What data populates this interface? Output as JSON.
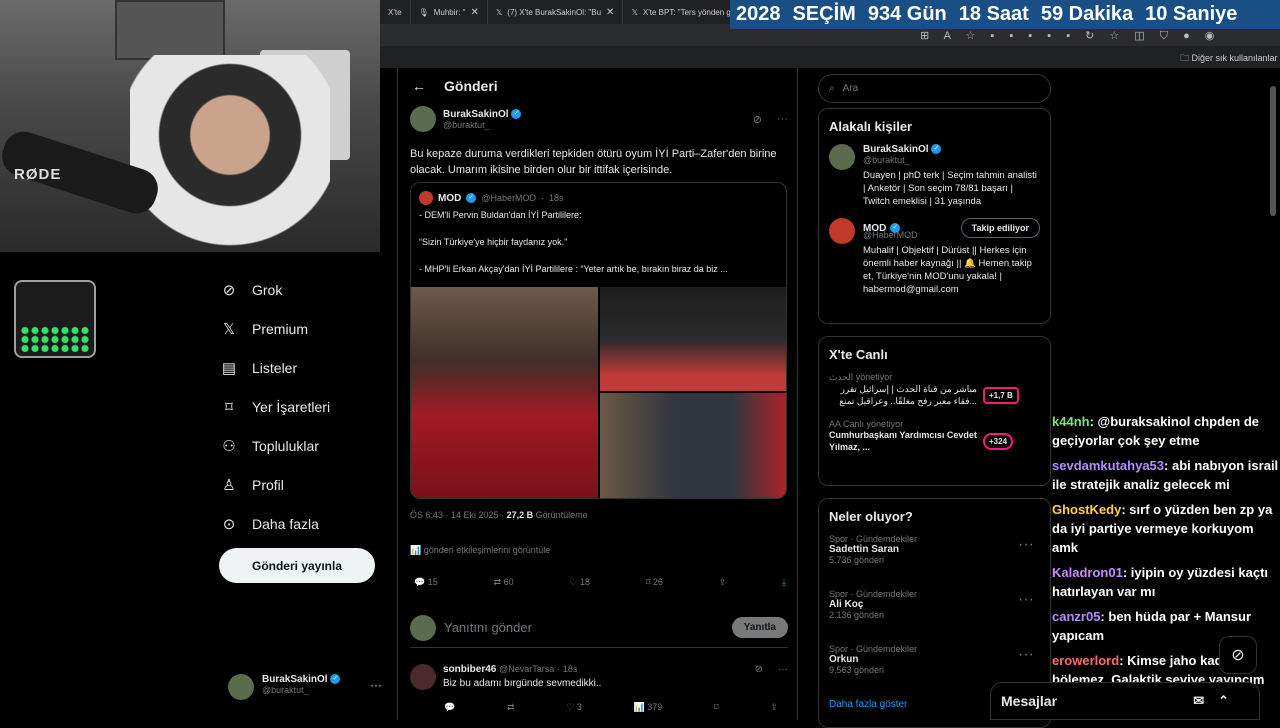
{
  "browser": {
    "tabs": [
      {
        "label": "X'te",
        "icon": "x-icon"
      },
      {
        "label": "Muhbir: \"",
        "icon": "mic-icon"
      },
      {
        "label": "(7) X'te BurakSakinOl: \"Bu",
        "icon": "x-icon"
      },
      {
        "label": "X'te BPT: \"Ters yönden gir",
        "icon": "x-icon"
      }
    ],
    "bookmarks_label": "Diğer sık kullanılanlar"
  },
  "counter": {
    "year": "2028",
    "label": "SEÇİM",
    "days": "934 Gün",
    "hours": "18 Saat",
    "minutes": "59 Dakika",
    "seconds": "10 Saniye"
  },
  "webcam": {
    "mic_brand": "RØDE"
  },
  "nav": {
    "items": [
      {
        "label": "Grok",
        "icon": "grok-icon",
        "glyph": "⊘"
      },
      {
        "label": "Premium",
        "icon": "x-logo-icon",
        "glyph": "𝕏"
      },
      {
        "label": "Listeler",
        "icon": "list-icon",
        "glyph": "▤"
      },
      {
        "label": "Yer İşaretleri",
        "icon": "bookmark-icon",
        "glyph": "⌑"
      },
      {
        "label": "Topluluklar",
        "icon": "communities-icon",
        "glyph": "⚇"
      },
      {
        "label": "Profil",
        "icon": "profile-icon",
        "glyph": "♙"
      },
      {
        "label": "Daha fazla",
        "icon": "more-circle-icon",
        "glyph": "⊙"
      }
    ],
    "post_button": "Gönderi yayınla",
    "me": {
      "name": "BurakSakinOl",
      "handle": "@buraktut_"
    }
  },
  "main": {
    "header": "Gönderi",
    "tweet": {
      "name": "BurakSakinOl",
      "handle": "@buraktut_",
      "text": "Bu kepaze duruma verdikleri tepkiden ötürü oyum İYİ Parti–Zafer'den birine olacak. Umarım ikisine birden olur bir ittifak içerisinde.",
      "quote": {
        "name": "MOD",
        "handle": "@HaberMOD",
        "time": "18s",
        "line1": "- DEM'li Pervin Buldan'dan İYİ Partililere:",
        "line2": "“Sizin Türkiye'ye hiçbir faydanız yok.”",
        "line3": "- MHP'li Erkan Akçay'dan İYİ Partililere : “Yeter artık be, bırakın biraz da biz ..."
      },
      "time": "ÖS 6:43 · 14 Eki 2025 ·",
      "views_count": "27,2 B",
      "views_label": "Görüntüleme",
      "analytics": "gönderi etkileşimlerini görüntüle",
      "actions": {
        "replies": "15",
        "reposts": "60",
        "likes": "18",
        "bookmarks": "26"
      }
    },
    "reply": {
      "placeholder": "Yanıtını gönder",
      "button": "Yanıtla"
    },
    "next_reply": {
      "name": "sonbiber46",
      "handle": "@NevarTarsa",
      "time": "18s",
      "text": "Biz bu adamı bırgünde sevmedikki..",
      "likes": "3",
      "views": "379"
    }
  },
  "right": {
    "search_placeholder": "Ara",
    "related": {
      "title": "Alakalı kişiler",
      "people": [
        {
          "name": "BurakSakinOl",
          "handle": "@buraktut_",
          "bio": "Duayen | phD terk | Seçim tahmin analisti | Anketör | Son seçim 78/81 başarı | Twitch emeklisi | 31 yaşında",
          "button": ""
        },
        {
          "name": "MOD",
          "handle": "@HaberMOD",
          "bio": "Muhalif | Objektif | Dürüst || Herkes için önemli haber kaynağı || 🔔 Hemen takip et, Türkiye'nin MOD'unu yakala! | habermod@gmail.com",
          "button": "Takip ediliyor"
        }
      ]
    },
    "live": {
      "title": "X'te Canlı",
      "items": [
        {
          "host": "الحدث",
          "status": "yönetiyor",
          "title": "مباشر من قناة الحدث | إسرائيل تقرر ...فقاء معبر رفح مغلقًا.. وعراقيل تمنع",
          "count": "+1,7 B"
        },
        {
          "host": "AA Canlı",
          "status": "yönetiyor",
          "title": "Cumhurbaşkanı Yardımcısı Cevdet Yılmaz, ...",
          "count": "+324"
        }
      ]
    },
    "trends": {
      "title": "Neler oluyor?",
      "items": [
        {
          "context": "Spor · Gündemdekiler",
          "name": "Sadettin Saran",
          "posts": "5.736 gönderi"
        },
        {
          "context": "Spor · Gündemdekiler",
          "name": "Ali Koç",
          "posts": "2.136 gönderi"
        },
        {
          "context": "Spor · Gündemdekiler",
          "name": "Orkun",
          "posts": "9.563 gönderi"
        }
      ],
      "show_more": "Daha fazla göster"
    }
  },
  "chat": [
    {
      "user": "k44nh",
      "text": "@buraksakinol chpden de geçiyorlar çok şey etme",
      "color": "#7fe07f"
    },
    {
      "user": "sevdamkutahya53",
      "text": "abi nabıyon israil ile stratejik analiz gelecek mi",
      "color": "#b88cff"
    },
    {
      "user": "GhostKedy",
      "text": "sırf o yüzden ben zp ya da iyi partiye vermeye korkuyom amk",
      "color": "#ffd23f"
    },
    {
      "user": "Kaladron01",
      "text": "iyipin oy yüzdesi kaçtı hatırlayan var mı",
      "color": "#c58cff"
    },
    {
      "user": "canzr05",
      "text": "ben hüda par + Mansur yapıcam",
      "color": "#b88cff"
    },
    {
      "user": "erowerlord",
      "text": "Kimse jaho kadar oy bölemez. Galaktik seviye yayıncım aq",
      "color": "#ff6b6b"
    }
  ],
  "messages_bar": "Mesajlar"
}
